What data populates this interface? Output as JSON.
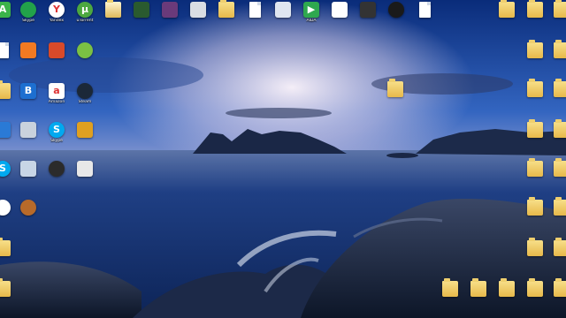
{
  "desktop": {
    "icons": [
      {
        "label": "",
        "icon": "green-app-icon",
        "color": "#3bb34a",
        "glyph": "A",
        "shape": "square"
      },
      {
        "label": "Skype",
        "icon": "green-circle-app-icon",
        "color": "#22a24a",
        "glyph": "",
        "shape": "round"
      },
      {
        "label": "Yandex",
        "icon": "yandex-browser-icon",
        "color": "#ffffff",
        "glyph": "Y",
        "shape": "round"
      },
      {
        "label": "uTorrent",
        "icon": "utorrent-icon",
        "color": "#4ca840",
        "glyph": "µ",
        "shape": "round"
      },
      {
        "label": "",
        "icon": "folder-open-icon",
        "color": "#f2d479",
        "glyph": "",
        "shape": "folder-open"
      },
      {
        "label": "",
        "icon": "game-shortcut-icon",
        "color": "#2a5a2f",
        "glyph": "",
        "shape": "square"
      },
      {
        "label": "",
        "icon": "game-shortcut-icon",
        "color": "#6a3a7a",
        "glyph": "",
        "shape": "square"
      },
      {
        "label": "",
        "icon": "drive-icon",
        "color": "#d9dde3",
        "glyph": "",
        "shape": "square"
      },
      {
        "label": "",
        "icon": "folder-icon",
        "color": "#f2c955",
        "glyph": "",
        "shape": "folder"
      },
      {
        "label": "",
        "icon": "document-icon",
        "color": "#ffffff",
        "glyph": "",
        "shape": "doc"
      },
      {
        "label": "",
        "icon": "network-shortcut-icon",
        "color": "#dfe6f0",
        "glyph": "",
        "shape": "square"
      },
      {
        "label": "AIDA",
        "icon": "play-arrow-icon",
        "color": "#2fa84f",
        "glyph": "▶",
        "shape": "square"
      },
      {
        "label": "",
        "icon": "java-icon",
        "color": "#ffffff",
        "glyph": "",
        "shape": "square"
      },
      {
        "label": "",
        "icon": "terminal-icon",
        "color": "#333333",
        "glyph": "",
        "shape": "square"
      },
      {
        "label": "",
        "icon": "paw-app-icon",
        "color": "#1a1a1a",
        "glyph": "",
        "shape": "round"
      },
      {
        "label": "",
        "icon": "document-icon",
        "color": "#ffffff",
        "glyph": "",
        "shape": "doc"
      },
      {
        "label": "",
        "icon": "document-icon",
        "color": "#ffffff",
        "glyph": "",
        "shape": "doc"
      },
      {
        "label": "",
        "icon": "orange-app-icon",
        "color": "#f27a22",
        "glyph": "",
        "shape": "square"
      },
      {
        "label": "",
        "icon": "rubiks-cube-icon",
        "color": "#d84a2a",
        "glyph": "",
        "shape": "square"
      },
      {
        "label": "",
        "icon": "green-star-app-icon",
        "color": "#7bc043",
        "glyph": "",
        "shape": "round"
      },
      {
        "label": "",
        "icon": "folder-icon",
        "color": "#f2c955",
        "glyph": "",
        "shape": "folder"
      },
      {
        "label": "",
        "icon": "blue-app-icon",
        "color": "#1d6fd0",
        "glyph": "B",
        "shape": "square"
      },
      {
        "label": "Amazon",
        "icon": "amazon-icon",
        "color": "#ffffff",
        "glyph": "a",
        "shape": "square"
      },
      {
        "label": "Steam",
        "icon": "steam-icon",
        "color": "#1b2838",
        "glyph": "",
        "shape": "round"
      },
      {
        "label": "",
        "icon": "gear-app-icon",
        "color": "#2a7ad6",
        "glyph": "",
        "shape": "square"
      },
      {
        "label": "",
        "icon": "recycle-bin-icon",
        "color": "#c9d2dd",
        "glyph": "",
        "shape": "square"
      },
      {
        "label": "Skype",
        "icon": "skype-icon",
        "color": "#00a9f0",
        "glyph": "S",
        "shape": "round"
      },
      {
        "label": "",
        "icon": "colorful-grid-icon",
        "color": "#e0a020",
        "glyph": "",
        "shape": "square"
      },
      {
        "label": "",
        "icon": "skype-icon",
        "color": "#00a9f0",
        "glyph": "S",
        "shape": "round"
      },
      {
        "label": "",
        "icon": "monitor-icon",
        "color": "#c8d6e6",
        "glyph": "",
        "shape": "square"
      },
      {
        "label": "",
        "icon": "headphones-icon",
        "color": "#2b2b2b",
        "glyph": "",
        "shape": "round"
      },
      {
        "label": "",
        "icon": "brush-app-icon",
        "color": "#e8e8e8",
        "glyph": "",
        "shape": "square"
      },
      {
        "label": "",
        "icon": "chrome-icon",
        "color": "#ffffff",
        "glyph": "",
        "shape": "round"
      },
      {
        "label": "",
        "icon": "basketball-icon",
        "color": "#b86a2a",
        "glyph": "",
        "shape": "round"
      },
      {
        "label": "",
        "icon": "folder-icon",
        "color": "#f2c955",
        "glyph": "",
        "shape": "folder"
      },
      {
        "label": "",
        "icon": "folder-icon",
        "color": "#f2c955",
        "glyph": "",
        "shape": "folder"
      },
      {
        "label": "",
        "icon": "folder-icon",
        "color": "#f2c955",
        "glyph": "",
        "shape": "folder"
      },
      {
        "label": "",
        "icon": "folder-icon",
        "color": "#f2c955",
        "glyph": "",
        "shape": "folder"
      },
      {
        "label": "",
        "icon": "folder-icon",
        "color": "#f2c955",
        "glyph": "",
        "shape": "folder"
      },
      {
        "label": "",
        "icon": "folder-icon",
        "color": "#f2c955",
        "glyph": "",
        "shape": "folder"
      },
      {
        "label": "",
        "icon": "folder-icon",
        "color": "#f2c955",
        "glyph": "",
        "shape": "folder"
      },
      {
        "label": "",
        "icon": "folder-icon",
        "color": "#f2c955",
        "glyph": "",
        "shape": "folder"
      },
      {
        "label": "",
        "icon": "folder-icon",
        "color": "#f2c955",
        "glyph": "",
        "shape": "folder"
      },
      {
        "label": "",
        "icon": "folder-icon",
        "color": "#f2c955",
        "glyph": "",
        "shape": "folder"
      },
      {
        "label": "",
        "icon": "folder-icon",
        "color": "#f2c955",
        "glyph": "",
        "shape": "folder"
      },
      {
        "label": "",
        "icon": "folder-icon",
        "color": "#f2c955",
        "glyph": "",
        "shape": "folder"
      },
      {
        "label": "",
        "icon": "folder-icon",
        "color": "#f2c955",
        "glyph": "",
        "shape": "folder"
      },
      {
        "label": "",
        "icon": "folder-icon",
        "color": "#f2c955",
        "glyph": "",
        "shape": "folder"
      },
      {
        "label": "",
        "icon": "folder-icon",
        "color": "#f2c955",
        "glyph": "",
        "shape": "folder"
      },
      {
        "label": "",
        "icon": "folder-icon",
        "color": "#f2c955",
        "glyph": "",
        "shape": "folder"
      },
      {
        "label": "",
        "icon": "folder-icon",
        "color": "#f2c955",
        "glyph": "",
        "shape": "folder"
      },
      {
        "label": "",
        "icon": "folder-icon",
        "color": "#f2c955",
        "glyph": "",
        "shape": "folder"
      },
      {
        "label": "",
        "icon": "folder-icon",
        "color": "#f2c955",
        "glyph": "",
        "shape": "folder"
      },
      {
        "label": "",
        "icon": "folder-icon",
        "color": "#f2c955",
        "glyph": "",
        "shape": "folder"
      },
      {
        "label": "",
        "icon": "folder-icon",
        "color": "#f2c955",
        "glyph": "",
        "shape": "folder"
      },
      {
        "label": "",
        "icon": "folder-icon",
        "color": "#f2c955",
        "glyph": "",
        "shape": "folder"
      },
      {
        "label": "",
        "icon": "folder-icon",
        "color": "#f2c955",
        "glyph": "",
        "shape": "folder"
      }
    ]
  },
  "colors": {
    "sky_top": "#0f3b8e",
    "sky_mid": "#3a6dc4",
    "horizon_glow": "#e9d6e6",
    "sea": "#14306e",
    "rocks": "#1c2a44"
  }
}
